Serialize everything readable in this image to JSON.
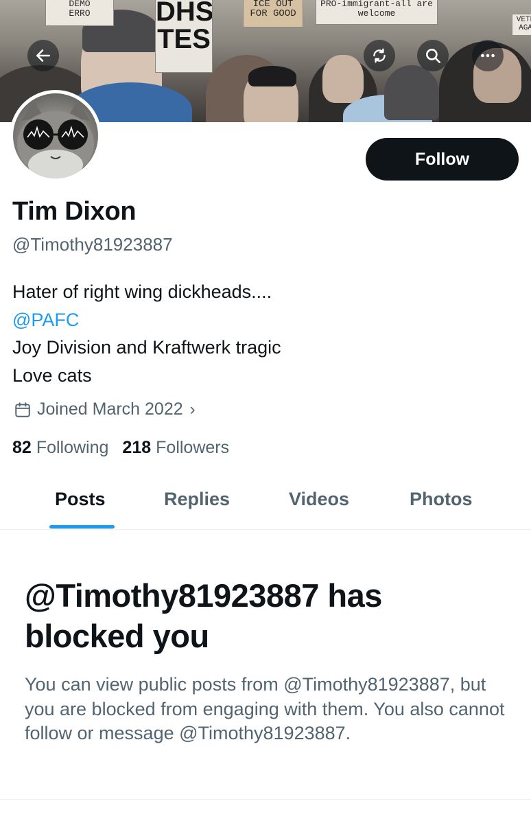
{
  "banner": {
    "signs": [
      "DHS",
      "TES",
      "ICE OUT",
      "FOR GOOD",
      "PRO-immigrant-all are",
      "welcome",
      "DEMO",
      "ERRO",
      "VETE",
      "AGA"
    ],
    "buttons": {
      "back_icon": "arrow-left-icon",
      "refresh_icon": "refresh-icon",
      "search_icon": "search-icon",
      "more_icon": "more-options-icon"
    }
  },
  "profile": {
    "name": "Tim Dixon",
    "handle": "@Timothy81923887",
    "follow_label": "Follow",
    "bio": {
      "line1": "Hater of right wing dickheads....",
      "mention": "@PAFC",
      "line3": "Joy Division and Kraftwerk tragic",
      "line4": "Love cats"
    },
    "joined": "Joined March 2022",
    "joined_chevron": "›",
    "following_count": "82",
    "following_label": "Following",
    "followers_count": "218",
    "followers_label": "Followers"
  },
  "tabs": {
    "posts": "Posts",
    "replies": "Replies",
    "videos": "Videos",
    "photos": "Photos"
  },
  "blocked": {
    "title": "@Timothy81923887 has blocked you",
    "description": "You can view public posts from @Timothy81923887, but you are blocked from engaging with them. You also cannot follow or message @Timothy81923887."
  },
  "colors": {
    "accent": "#1d9bf0",
    "text_primary": "#0f1419",
    "text_secondary": "#536471",
    "follow_button_bg": "#0f1419"
  }
}
